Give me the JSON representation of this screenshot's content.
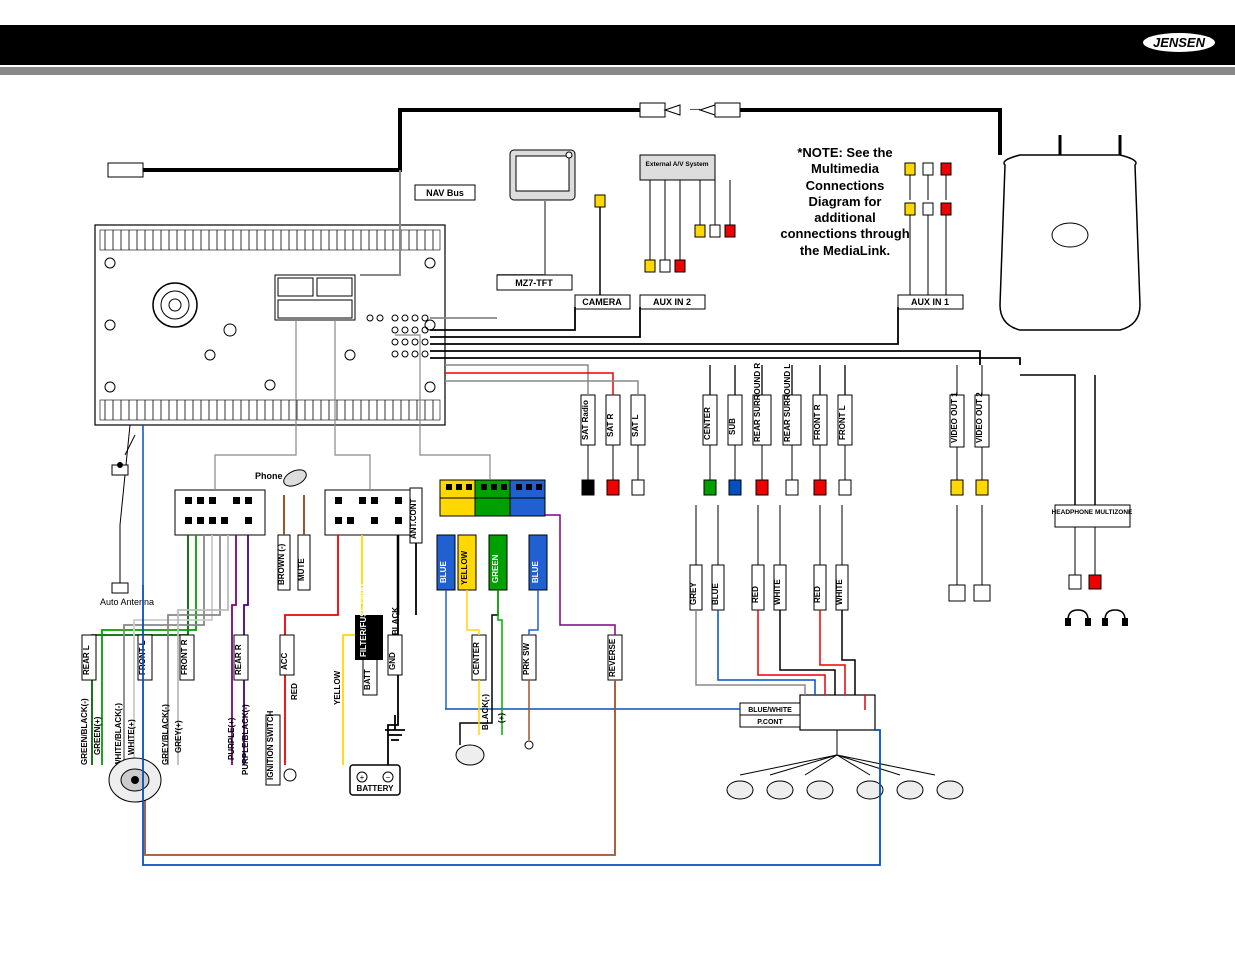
{
  "brand": "JENSEN",
  "note": "*NOTE: See the Multimedia Connections Diagram for additional connections through the MediaLink.",
  "labels": {
    "nav_bus": "NAV Bus",
    "mz7_tft": "MZ7-TFT",
    "camera": "CAMERA",
    "aux_in2": "AUX IN 2",
    "aux_in1": "AUX IN 1",
    "ext_av": "External A/V System",
    "auto_antenna": "Auto Antenna",
    "phone": "Phone",
    "headphone_multizone": "HEADPHONE MULTIZONE",
    "filter_fuse": "FILTER/FUSE (30A)",
    "ignition_switch": "IGNITION SWITCH",
    "battery": "BATTERY"
  },
  "wire_labels_vertical": {
    "rear_l": "REAR L",
    "front_l": "FRONT L",
    "front_r": "FRONT R",
    "rear_r": "REAR R",
    "acc": "ACC",
    "batt": "BATT",
    "gnd": "GND",
    "ant_cont": "ANT.CONT",
    "brown_neg": "BROWN (-)",
    "mute": "MUTE",
    "blue": "BLUE",
    "yellow": "YELLOW",
    "green": "GREEN",
    "center": "CENTER",
    "prk_sw": "PRK SW",
    "reverse": "REVERSE",
    "black": "BLACK",
    "black_neg": "BLACK(-)",
    "black_pos": "(+)",
    "sat_radio": "SAT Radio",
    "sat_r": "SAT R",
    "sat_l": "SAT L",
    "center2": "CENTER",
    "sub": "SUB",
    "rear_surround_r": "REAR SURROUND R",
    "rear_surround_l": "REAR SURROUND L",
    "front_r2": "FRONT R",
    "front_l2": "FRONT L",
    "video_out1": "VIDEO OUT 1",
    "video_out2": "VIDEO OUT 2",
    "grey": "GREY",
    "blue2": "BLUE",
    "red": "RED",
    "white": "WHITE",
    "red2": "RED",
    "white2": "WHITE",
    "red3": "RED",
    "blue_white": "BLUE/WHITE",
    "p_cont": "P.CONT",
    "green_black_neg": "GREEN/BLACK(-)",
    "green_pos": "GREEN(+)",
    "white_black_neg": "WHITE/BLACK(-)",
    "white_pos": "WHITE(+)",
    "grey_black_neg": "GREY/BLACK(-)",
    "grey_pos": "GREY(+)",
    "purple_pos": "PURPLE(+)",
    "purple_black_neg": "PURPLE/BLACK(-)",
    "yellow2": "YELLOW"
  }
}
